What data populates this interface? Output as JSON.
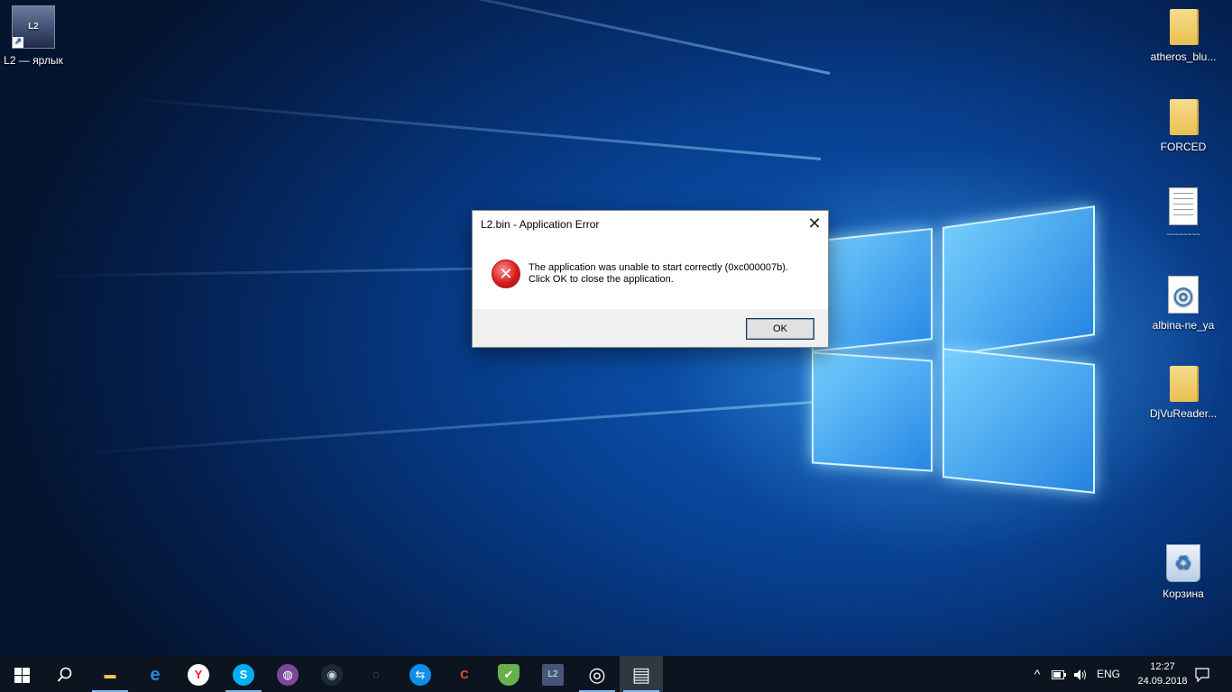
{
  "desktop": {
    "icons_left": [
      {
        "label": "L2 — ярлык",
        "icon": "l2-shortcut-icon"
      }
    ],
    "icons_right": [
      {
        "label": "atheros_blu...",
        "icon": "folder-icon"
      },
      {
        "label": "FORCED",
        "icon": "folder-icon"
      },
      {
        "label": "~~~~~~~~",
        "icon": "document-icon"
      },
      {
        "label": "albina-ne_ya",
        "icon": "media-file-icon"
      },
      {
        "label": "DjVuReader...",
        "icon": "folder-icon"
      },
      {
        "label": "Корзина",
        "icon": "recycle-bin-icon"
      }
    ]
  },
  "dialog": {
    "title": "L2.bin - Application Error",
    "message_line1": "The application was unable to start correctly (0xc000007b).",
    "message_line2": "Click OK to close the application.",
    "ok_label": "OK",
    "close_glyph": "✕"
  },
  "taskbar": {
    "start_icon": "windows-start-icon",
    "search_icon": "search-icon",
    "apps": [
      {
        "name": "file-explorer-icon",
        "glyph": "▬",
        "color": "#f2c94c"
      },
      {
        "name": "edge-icon",
        "glyph": "e",
        "color": "#2b88d8"
      },
      {
        "name": "yandex-browser-icon",
        "glyph": "Y",
        "color": "#e5252a"
      },
      {
        "name": "skype-icon",
        "glyph": "S",
        "color": "#00aff0"
      },
      {
        "name": "tor-browser-icon",
        "glyph": "◍",
        "color": "#7d4698"
      },
      {
        "name": "steam-icon",
        "glyph": "◉",
        "color": "#c7d5e0"
      },
      {
        "name": "loader-icon",
        "glyph": "◌",
        "color": "#3a8bd8"
      },
      {
        "name": "teamviewer-icon",
        "glyph": "⇆",
        "color": "#0e8ee9"
      },
      {
        "name": "ccleaner-icon",
        "glyph": "C",
        "color": "#e4572e"
      },
      {
        "name": "adguard-icon",
        "glyph": "✔",
        "color": "#67b04b"
      },
      {
        "name": "l2-app-icon",
        "glyph": "L2",
        "color": "#48557a"
      },
      {
        "name": "media-player-icon",
        "glyph": "◎",
        "color": "#ffffff"
      },
      {
        "name": "active-window-icon",
        "glyph": "▤",
        "color": "#dfe8f0"
      }
    ],
    "tray": {
      "chevron": "^",
      "language": "ENG",
      "time": "12:27",
      "date": "24.09.2018"
    }
  }
}
